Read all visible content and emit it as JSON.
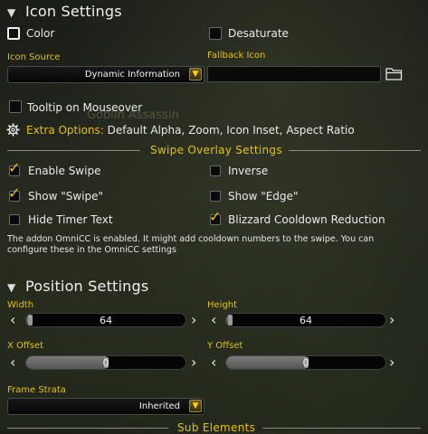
{
  "icon_settings": {
    "header": "Icon Settings",
    "color_label": "Color",
    "desaturate_label": "Desaturate",
    "icon_source_label": "Icon Source",
    "icon_source_value": "Dynamic Information",
    "fallback_icon_label": "Fallback Icon",
    "fallback_icon_value": "",
    "tooltip_label": "Tooltip on Mouseover",
    "extra_options_label": "Extra Options:",
    "extra_options_value": "Default Alpha, Zoom, Icon Inset, Aspect Ratio",
    "bg_text": "Goblin Assassin"
  },
  "swipe_overlay": {
    "title": "Swipe Overlay Settings",
    "enable_swipe": {
      "label": "Enable Swipe",
      "checked": true
    },
    "inverse": {
      "label": "Inverse",
      "checked": false
    },
    "show_swipe": {
      "label": "Show \"Swipe\"",
      "checked": true
    },
    "show_edge": {
      "label": "Show \"Edge\"",
      "checked": false
    },
    "hide_timer": {
      "label": "Hide Timer Text",
      "checked": false
    },
    "blizzard_cooldown": {
      "label": "Blizzard Cooldown Reduction",
      "checked": true
    },
    "note_line1": "The addon OmniCC is enabled. It might add cooldown numbers to the swipe. You can",
    "note_line2": "configure these in the OmniCC settings"
  },
  "position_settings": {
    "header": "Position Settings",
    "width": {
      "label": "Width",
      "value": "64",
      "fill": 0.02
    },
    "height": {
      "label": "Height",
      "value": "64",
      "fill": 0.02
    },
    "x_offset": {
      "label": "X Offset",
      "value": "0",
      "fill": 0.5
    },
    "y_offset": {
      "label": "Y Offset",
      "value": "0",
      "fill": 0.5
    },
    "frame_strata_label": "Frame Strata",
    "frame_strata_value": "Inherited"
  },
  "sub_elements_title": "Sub Elements",
  "colors": {
    "accent_gold": "#e6c200",
    "background": "#1f221b"
  }
}
